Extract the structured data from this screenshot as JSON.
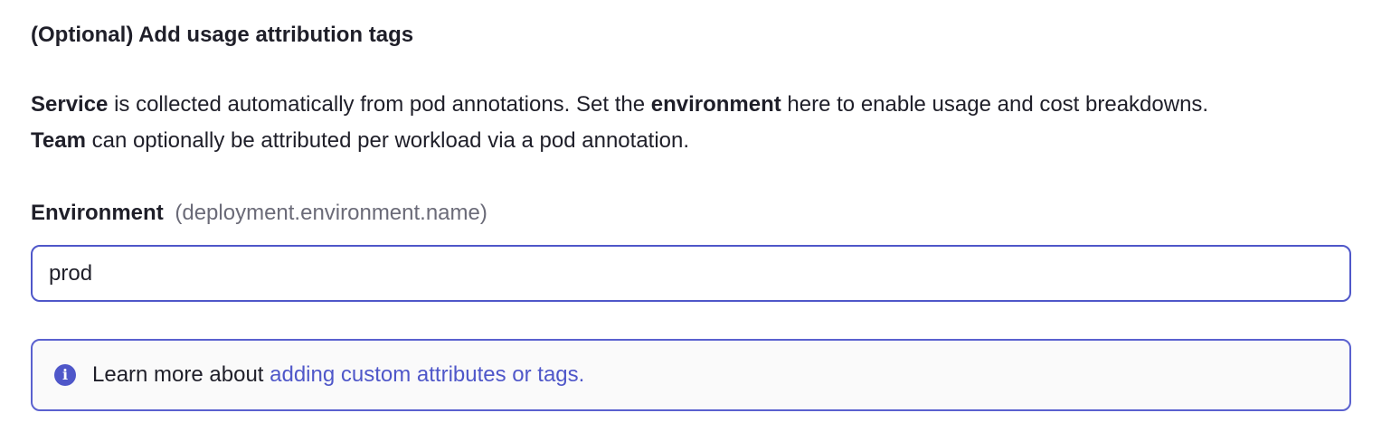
{
  "section": {
    "title": "(Optional) Add usage attribution tags"
  },
  "description": {
    "line1_bold1": "Service",
    "line1_text1": " is collected automatically from pod annotations. Set the ",
    "line1_bold2": "environment",
    "line1_text2": " here to enable usage and cost breakdowns.",
    "line2_bold": "Team",
    "line2_text": " can optionally be attributed per workload via a pod annotation."
  },
  "environment_field": {
    "label": "Environment",
    "hint": "(deployment.environment.name)",
    "value": "prod"
  },
  "info_box": {
    "icon": "info-icon",
    "text": "Learn more about ",
    "link_text": "adding custom attributes or tags."
  },
  "colors": {
    "accent": "#4f57c9",
    "text": "#1f1f29",
    "muted": "#6b6b78"
  }
}
